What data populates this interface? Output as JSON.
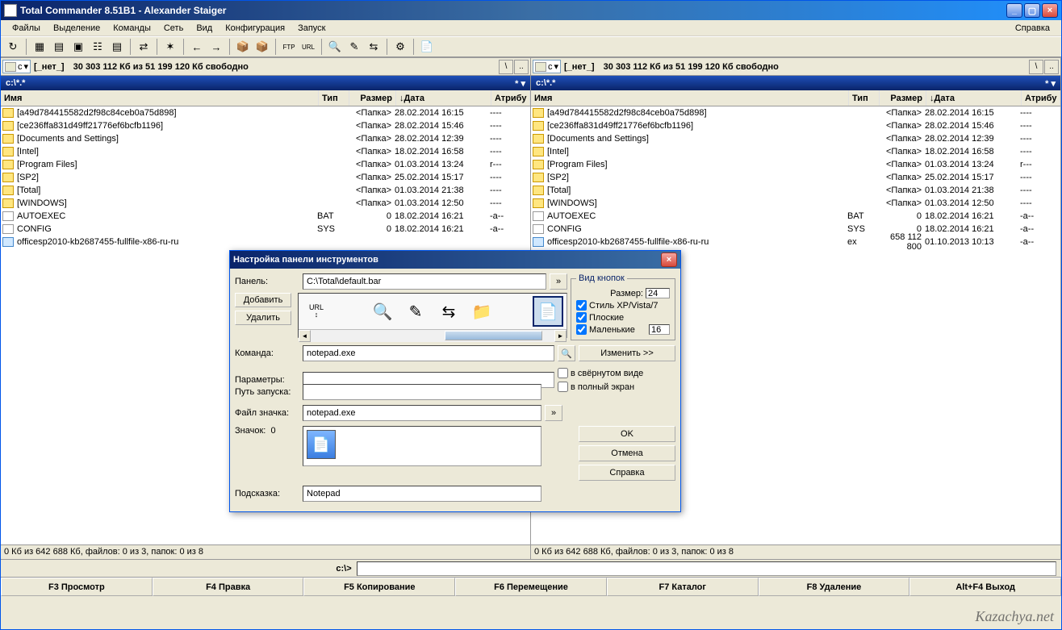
{
  "window": {
    "title": "Total Commander 8.51B1 - Alexander Staiger",
    "menu": [
      "Файлы",
      "Выделение",
      "Команды",
      "Сеть",
      "Вид",
      "Конфигурация",
      "Запуск"
    ],
    "help": "Справка"
  },
  "drive": {
    "letter": "c",
    "label": "[_нет_]",
    "space": "30 303 112 Кб из 51 199 120 Кб свободно"
  },
  "path": "c:\\*.*",
  "columns": {
    "name": "Имя",
    "type": "Тип",
    "size": "Размер",
    "date": "↓Дата",
    "attr": "Атрибу"
  },
  "files": [
    {
      "icon": "folder",
      "name": "[a49d784415582d2f98c84ceb0a75d898]",
      "ext": "",
      "size": "<Папка>",
      "date": "28.02.2014 16:15",
      "attr": "----"
    },
    {
      "icon": "folder",
      "name": "[ce236ffa831d49ff21776ef6bcfb1196]",
      "ext": "",
      "size": "<Папка>",
      "date": "28.02.2014 15:46",
      "attr": "----"
    },
    {
      "icon": "folder",
      "name": "[Documents and Settings]",
      "ext": "",
      "size": "<Папка>",
      "date": "28.02.2014 12:39",
      "attr": "----"
    },
    {
      "icon": "folder",
      "name": "[Intel]",
      "ext": "",
      "size": "<Папка>",
      "date": "18.02.2014 16:58",
      "attr": "----"
    },
    {
      "icon": "folder",
      "name": "[Program Files]",
      "ext": "",
      "size": "<Папка>",
      "date": "01.03.2014 13:24",
      "attr": "r---"
    },
    {
      "icon": "folder",
      "name": "[SP2]",
      "ext": "",
      "size": "<Папка>",
      "date": "25.02.2014 15:17",
      "attr": "----"
    },
    {
      "icon": "folder",
      "name": "[Total]",
      "ext": "",
      "size": "<Папка>",
      "date": "01.03.2014 21:38",
      "attr": "----"
    },
    {
      "icon": "folder",
      "name": "[WINDOWS]",
      "ext": "",
      "size": "<Папка>",
      "date": "01.03.2014 12:50",
      "attr": "----"
    },
    {
      "icon": "file",
      "name": "AUTOEXEC",
      "ext": "BAT",
      "size": "0",
      "date": "18.02.2014 16:21",
      "attr": "-a--"
    },
    {
      "icon": "file",
      "name": "CONFIG",
      "ext": "SYS",
      "size": "0",
      "date": "18.02.2014 16:21",
      "attr": "-a--"
    },
    {
      "icon": "exe",
      "name": "officesp2010-kb2687455-fullfile-x86-ru-ru",
      "ext": "",
      "size": "",
      "date": "",
      "attr": ""
    }
  ],
  "files_right_extra": {
    "icon": "exe",
    "name": "officesp2010-kb2687455-fullfile-x86-ru-ru",
    "ext": "ex",
    "size": "658 112 800",
    "date": "01.10.2013 10:13",
    "attr": "-a--"
  },
  "status": "0 Кб из 642 688 Кб, файлов: 0 из 3, папок: 0 из 8",
  "cmdline_label": "c:\\>",
  "fkeys": [
    "F3 Просмотр",
    "F4 Правка",
    "F5 Копирование",
    "F6 Перемещение",
    "F7 Каталог",
    "F8 Удаление",
    "Alt+F4 Выход"
  ],
  "dialog": {
    "title": "Настройка панели инструментов",
    "panel_label": "Панель:",
    "panel_value": "C:\\Total\\default.bar",
    "add": "Добавить",
    "del": "Удалить",
    "view_group": "Вид кнопок",
    "size_label": "Размер:",
    "size_value": "24",
    "style_xp": "Стиль XP/Vista/7",
    "flat": "Плоские",
    "small": "Маленькие",
    "small_value": "16",
    "cmd_label": "Команда:",
    "cmd_value": "notepad.exe",
    "change": "Изменить >>",
    "params_label": "Параметры:",
    "startup_label": "Путь запуска:",
    "minimized": "в свёрнутом виде",
    "fullscreen": "в полный экран",
    "iconfile_label": "Файл значка:",
    "iconfile_value": "notepad.exe",
    "icon_label": "Значок:",
    "icon_index": "0",
    "hint_label": "Подсказка:",
    "hint_value": "Notepad",
    "ok": "OK",
    "cancel": "Отмена",
    "help": "Справка"
  },
  "watermark": "Kazachya.net"
}
